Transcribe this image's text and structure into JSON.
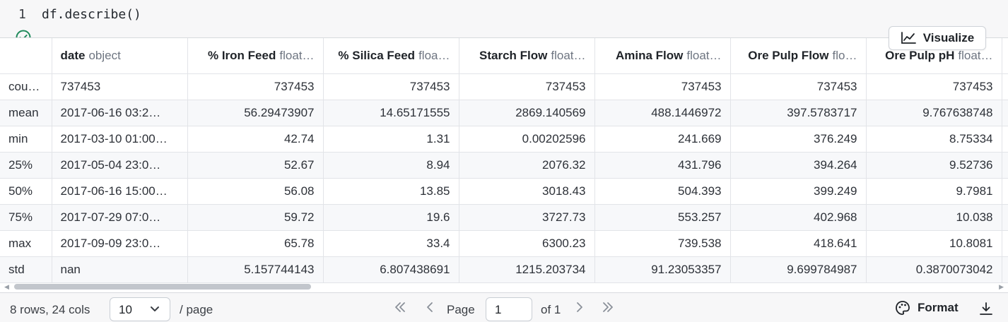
{
  "code": {
    "line_number": "1",
    "text": "df.describe()"
  },
  "toolbar": {
    "visualize_label": "Visualize"
  },
  "table": {
    "columns": [
      {
        "name": "",
        "dtype": ""
      },
      {
        "name": "date",
        "dtype": "object"
      },
      {
        "name": "% Iron Feed",
        "dtype": "float…"
      },
      {
        "name": "% Silica Feed",
        "dtype": "floa…"
      },
      {
        "name": "Starch Flow",
        "dtype": "float…"
      },
      {
        "name": "Amina Flow",
        "dtype": "float…"
      },
      {
        "name": "Ore Pulp Flow",
        "dtype": "flo…"
      },
      {
        "name": "Ore Pulp pH",
        "dtype": "float…"
      }
    ],
    "rows": [
      [
        "cou…",
        "737453",
        "737453",
        "737453",
        "737453",
        "737453",
        "737453",
        "737453"
      ],
      [
        "mean",
        "2017-06-16 03:2…",
        "56.29473907",
        "14.65171555",
        "2869.140569",
        "488.1446972",
        "397.5783717",
        "9.767638748"
      ],
      [
        "min",
        "2017-03-10 01:00…",
        "42.74",
        "1.31",
        "0.00202596",
        "241.669",
        "376.249",
        "8.75334"
      ],
      [
        "25%",
        "2017-05-04 23:0…",
        "52.67",
        "8.94",
        "2076.32",
        "431.796",
        "394.264",
        "9.52736"
      ],
      [
        "50%",
        "2017-06-16 15:00…",
        "56.08",
        "13.85",
        "3018.43",
        "504.393",
        "399.249",
        "9.7981"
      ],
      [
        "75%",
        "2017-07-29 07:0…",
        "59.72",
        "19.6",
        "3727.73",
        "553.257",
        "402.968",
        "10.038"
      ],
      [
        "max",
        "2017-09-09 23:0…",
        "65.78",
        "33.4",
        "6300.23",
        "739.538",
        "418.641",
        "10.8081"
      ],
      [
        "std",
        "nan",
        "5.157744143",
        "6.807438691",
        "1215.203734",
        "91.23053357",
        "9.699784987",
        "0.3870073042"
      ]
    ]
  },
  "footer": {
    "rows_info": "8 rows, 24 cols",
    "page_size": "10",
    "per_page": "/ page",
    "page_label": "Page",
    "page_value": "1",
    "page_of": "of 1",
    "format_label": "Format"
  },
  "colors": {
    "success": "#1f8a5b",
    "accent": "#1f2328"
  }
}
